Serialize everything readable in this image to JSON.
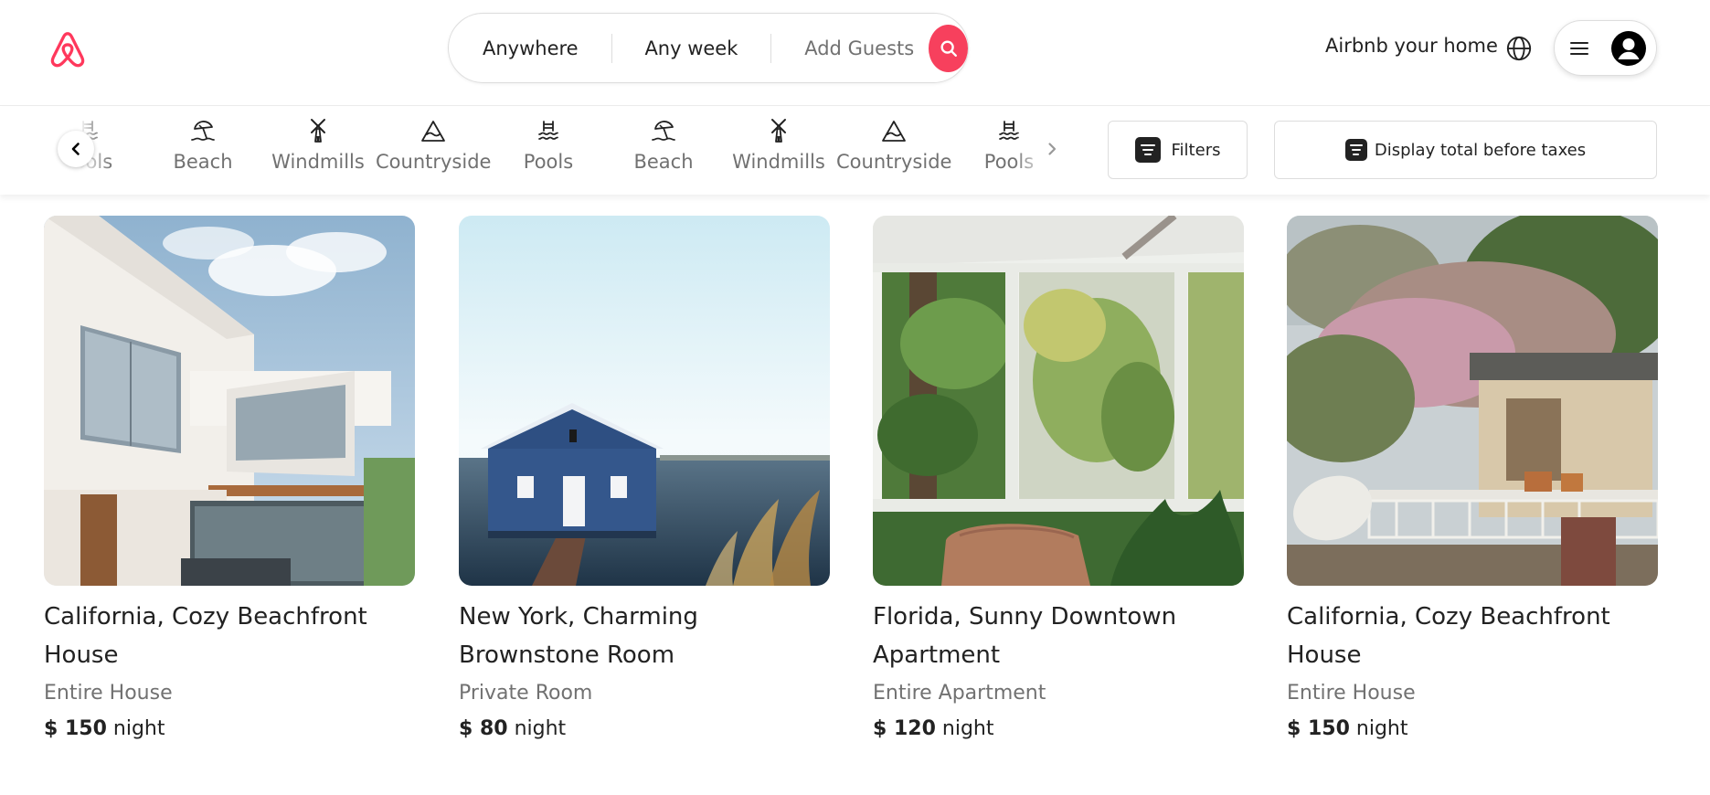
{
  "header": {
    "logo_icon": "airbnb-logo-icon",
    "brand_color": "#ff385c",
    "search": {
      "location_label": "Anywhere",
      "dates_label": "Any week",
      "guests_label": "Add Guests",
      "search_icon": "search-icon",
      "button_color": "#f7405d"
    },
    "host_link": "Airbnb your home",
    "globe_icon": "globe-icon",
    "menu_icon": "hamburger-menu-icon",
    "avatar_icon": "user-avatar-icon"
  },
  "categories": {
    "items": [
      {
        "label": "Pools",
        "icon": "pool-icon"
      },
      {
        "label": "Beach",
        "icon": "beach-icon"
      },
      {
        "label": "Windmills",
        "icon": "windmill-icon"
      },
      {
        "label": "Countryside",
        "icon": "countryside-icon"
      },
      {
        "label": "Pools",
        "icon": "pool-icon"
      },
      {
        "label": "Beach",
        "icon": "beach-icon"
      },
      {
        "label": "Windmills",
        "icon": "windmill-icon"
      },
      {
        "label": "Countryside",
        "icon": "countryside-icon"
      },
      {
        "label": "Pools",
        "icon": "pool-icon"
      }
    ],
    "prev_icon": "chevron-left-icon",
    "next_icon": "chevron-right-icon",
    "filters_label": "Filters",
    "taxes_label": "Display total before taxes"
  },
  "listings": [
    {
      "title": "California, Cozy Beachfront House",
      "type": "Entire House",
      "price": "$ 150",
      "unit": "night",
      "photo": "modern white house with glass windows"
    },
    {
      "title": "New York, Charming Brownstone Room",
      "type": "Private Room",
      "price": "$ 80",
      "unit": "night",
      "photo": "blue boathouse on a lake"
    },
    {
      "title": "Florida, Sunny Downtown Apartment",
      "type": "Entire Apartment",
      "price": "$ 120",
      "unit": "night",
      "photo": "sunroom with chair and plants"
    },
    {
      "title": "California, Cozy Beachfront House",
      "type": "Entire House",
      "price": "$ 150",
      "unit": "night",
      "photo": "house with flowering tree and balcony"
    }
  ]
}
